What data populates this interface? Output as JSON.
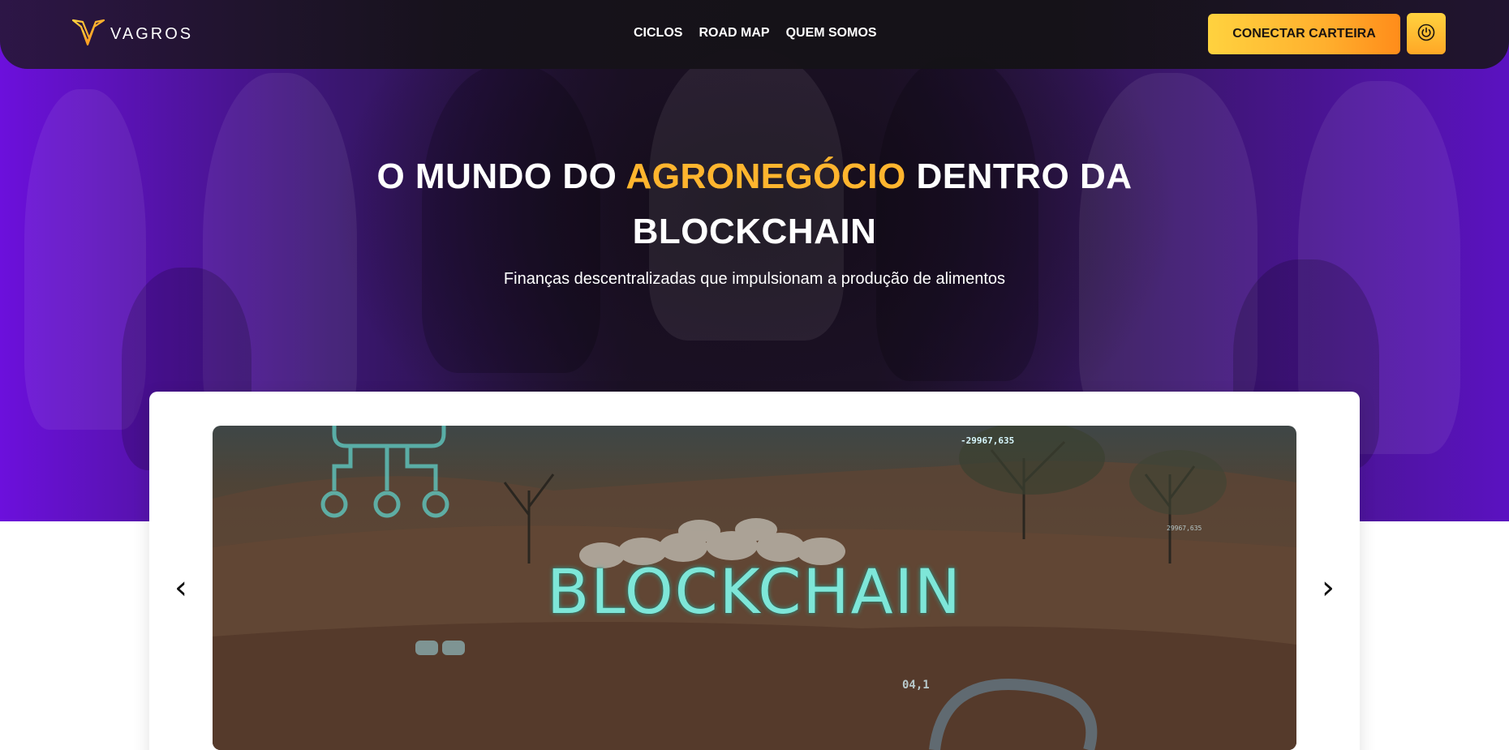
{
  "brand": {
    "name": "VAGROS",
    "logo_icon": "vagros-v-logo-icon",
    "accent_color": "#ffb02e"
  },
  "nav": {
    "links": [
      "CICLOS",
      "ROAD MAP",
      "QUEM SOMOS"
    ],
    "connect_button": "CONECTAR CARTEIRA",
    "power_icon": "power-icon"
  },
  "hero": {
    "title_part1": "O MUNDO DO ",
    "title_accent": "AGRONEGÓCIO",
    "title_part2": " DENTRO DA BLOCKCHAIN",
    "subtitle": "Finanças descentralizadas que impulsionam a produção de alimentos"
  },
  "carousel": {
    "prev_icon": "chevron-left-icon",
    "next_icon": "chevron-right-icon",
    "prev_label": "‹",
    "next_label": "›",
    "slide": {
      "title": "BLOCKCHAIN",
      "readout_top": "-29967,635",
      "readout_right": "29967,635",
      "readout_bottom": "04,1"
    }
  },
  "colors": {
    "hero_purple": "#6c10dc",
    "button_yellow": "#ffd23f",
    "button_orange": "#ff8c1a",
    "slide_text_cyan": "#7ee6d8"
  }
}
